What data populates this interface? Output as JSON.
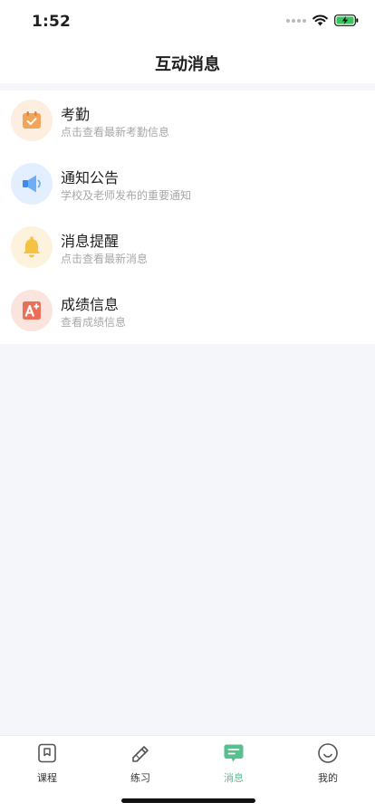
{
  "status_bar": {
    "time": "1:52"
  },
  "header": {
    "title": "互动消息"
  },
  "items": [
    {
      "title": "考勤",
      "subtitle": "点击查看最新考勤信息",
      "icon": "calendar-check-icon",
      "bg": "#fdeee0",
      "color": "#f0a55a"
    },
    {
      "title": "通知公告",
      "subtitle": "学校及老师发布的重要通知",
      "icon": "megaphone-icon",
      "bg": "#e3efff",
      "color": "#5aa0f0"
    },
    {
      "title": "消息提醒",
      "subtitle": "点击查看最新消息",
      "icon": "bell-icon",
      "bg": "#fdf3dd",
      "color": "#f5c243"
    },
    {
      "title": "成绩信息",
      "subtitle": "查看成绩信息",
      "icon": "grade-a-plus-icon",
      "bg": "#fbe3de",
      "color": "#ea6f59"
    }
  ],
  "tabbar": {
    "tabs": [
      {
        "label": "课程",
        "icon": "bookmark-icon"
      },
      {
        "label": "练习",
        "icon": "pencil-icon"
      },
      {
        "label": "消息",
        "icon": "message-icon",
        "active": true
      },
      {
        "label": "我的",
        "icon": "smiley-icon"
      }
    ],
    "active_color": "#58bf8e"
  }
}
